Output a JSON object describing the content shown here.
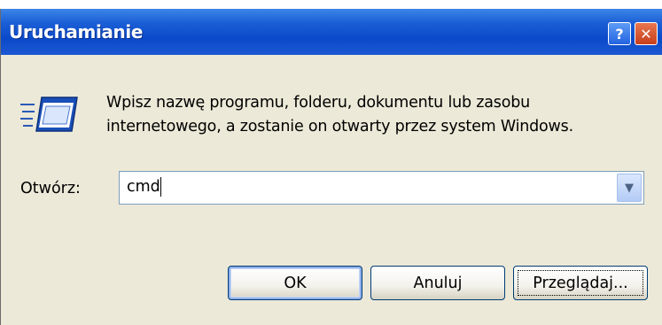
{
  "dialog": {
    "title": "Uruchamianie",
    "help_button": "?",
    "close_button": "✕",
    "description_line1": "Wpisz nazwę programu, folderu, dokumentu lub zasobu",
    "description_line2": "internetowego, a zostanie on otwarty przez system Windows.",
    "open_label": "Otwórz:",
    "open_value": "cmd",
    "dropdown_arrow": "▼",
    "ok_label": "OK",
    "cancel_label": "Anuluj",
    "browse_label": "Przeglądaj..."
  },
  "colors": {
    "titlebar": "#0a49c9",
    "dialog_bg": "#ece9d8",
    "close_button": "#c83f1c",
    "button_border": "#003c74"
  },
  "icons": {
    "program": "run-program-icon"
  }
}
